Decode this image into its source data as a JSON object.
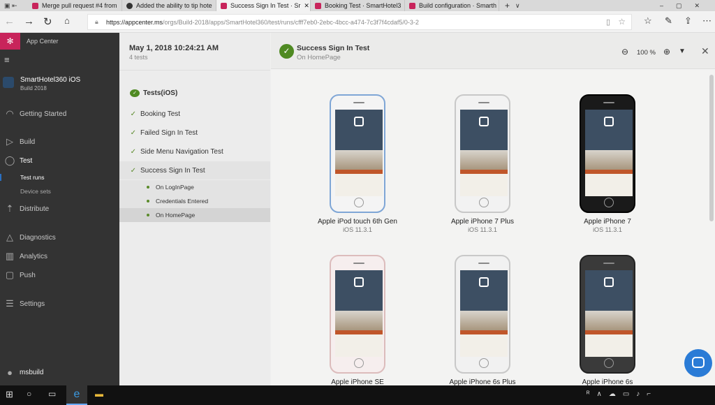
{
  "browser": {
    "tabs": [
      "Merge pull request #4 from",
      "Added the ability to tip hote",
      "Success Sign In Test · Sr",
      "Booking Test · SmartHotel3",
      "Build configuration · Smarth"
    ],
    "url_host": "https://appcenter.ms",
    "url_path": "/orgs/Build-2018/apps/SmartHotel360/test/runs/cfff7eb0-2ebc-4bcc-a474-7c3f7f4cdaf5/0-3-2"
  },
  "sidebar": {
    "brand": "App Center",
    "app_name": "SmartHotel360 iOS",
    "app_sub": "Build 2018",
    "items": [
      "Getting Started",
      "Build",
      "Test",
      "Test runs",
      "Device sets",
      "Distribute",
      "Diagnostics",
      "Analytics",
      "Push",
      "Settings"
    ],
    "user": "msbuild"
  },
  "run": {
    "date": "May 1, 2018 10:24:21 AM",
    "count": "4 tests",
    "root": "Tests(iOS)",
    "tests": [
      "Booking Test",
      "Failed Sign In Test",
      "Side Menu Navigation Test",
      "Success Sign In Test"
    ],
    "steps": [
      "On LogInPage",
      "Credentials Entered",
      "On HomePage"
    ]
  },
  "detail": {
    "title": "Success Sign In Test",
    "subtitle": "On HomePage",
    "zoom": "100 %",
    "devices": [
      {
        "name": "Apple iPod touch 6th Gen",
        "os": "iOS 11.3.1",
        "color": "#f4f4f4",
        "border": "#7fa6d6"
      },
      {
        "name": "Apple iPhone 7 Plus",
        "os": "iOS 11.3.1",
        "color": "#f2f2f2",
        "border": "#c8c8c8"
      },
      {
        "name": "Apple iPhone 7",
        "os": "iOS 11.3.1",
        "color": "#1a1a1a",
        "border": "#000000"
      },
      {
        "name": "Apple iPhone SE",
        "os": "",
        "color": "#f6eeee",
        "border": "#dcbcbc"
      },
      {
        "name": "Apple iPhone 6s Plus",
        "os": "",
        "color": "#f1f1f1",
        "border": "#c8c8c8"
      },
      {
        "name": "Apple iPhone 6s",
        "os": "",
        "color": "#3a3a3a",
        "border": "#222222"
      }
    ]
  }
}
